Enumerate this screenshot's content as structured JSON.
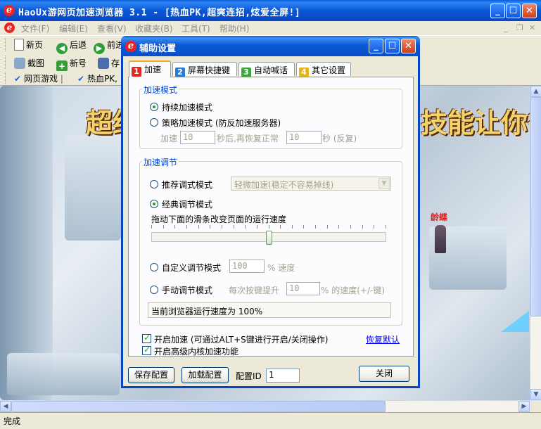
{
  "window": {
    "title": "HaoUx游网页加速浏览器 3.1 - [热血PK,超爽连招,炫爱全屏!]",
    "logo_letter": "e"
  },
  "menu": {
    "items": [
      "文件(F)",
      "编辑(E)",
      "查看(V)",
      "收藏夹(B)",
      "工具(T)",
      "帮助(H)"
    ]
  },
  "toolbar": {
    "new_page": "新页",
    "back": "后退",
    "forward": "前进",
    "screenshot": "截图",
    "new_account": "新号",
    "save": "存",
    "fav_web_games": "网页游戏",
    "fav_hot_pk": "热血PK,"
  },
  "game": {
    "banner_left": "超约",
    "banner_right": "技能让你征",
    "npc_name": "龄蝶"
  },
  "status": {
    "text": "完成"
  },
  "dialog": {
    "title": "辅助设置",
    "tabs": [
      {
        "num": "1",
        "label": "加速",
        "color": "#e0281e"
      },
      {
        "num": "2",
        "label": "屏幕快捷键",
        "color": "#2a7bd6"
      },
      {
        "num": "3",
        "label": "自动喊话",
        "color": "#3aa63a"
      },
      {
        "num": "4",
        "label": "其它设置",
        "color": "#e8b21a"
      }
    ],
    "accel_mode": {
      "legend": "加速模式",
      "continuous": "持续加速模式",
      "strategy": "策略加速模式 (防反加速服务器)",
      "accel_prefix": "加速",
      "accel_seconds": "10",
      "mid_text": "秒后,再恢复正常",
      "normal_seconds": "10",
      "suffix": "秒 (反复)"
    },
    "accel_adjust": {
      "legend": "加速调节",
      "recommended": "推荐调式模式",
      "recommended_option": "轻微加速(稳定不容易掉线)",
      "classic": "经典调节模式",
      "slider_hint": "拖动下面的滑条改变页面的运行速度",
      "slider_level": 0.5,
      "custom": "自定义调节模式",
      "custom_value": "100",
      "custom_suffix": "% 速度",
      "manual": "手动调节模式",
      "manual_prefix": "每次按键提升",
      "manual_value": "10",
      "manual_suffix": "% 的速度(+/-键)",
      "current_speed": "当前浏览器运行速度为 100%"
    },
    "enable_accel": "开启加速 (可通过ALT+S键进行开启/关闭操作)",
    "enable_kernel": "开启高级内核加速功能",
    "restore_default": "恢复默认",
    "save_config": "保存配置",
    "load_config": "加载配置",
    "config_id_label": "配置ID",
    "config_id_value": "1",
    "close": "关闭"
  },
  "colors": {
    "titlebar_blue": "#0b58d6",
    "legend_blue": "#0046d5",
    "radio_green": "#21a121",
    "close_red": "#c9401c"
  }
}
